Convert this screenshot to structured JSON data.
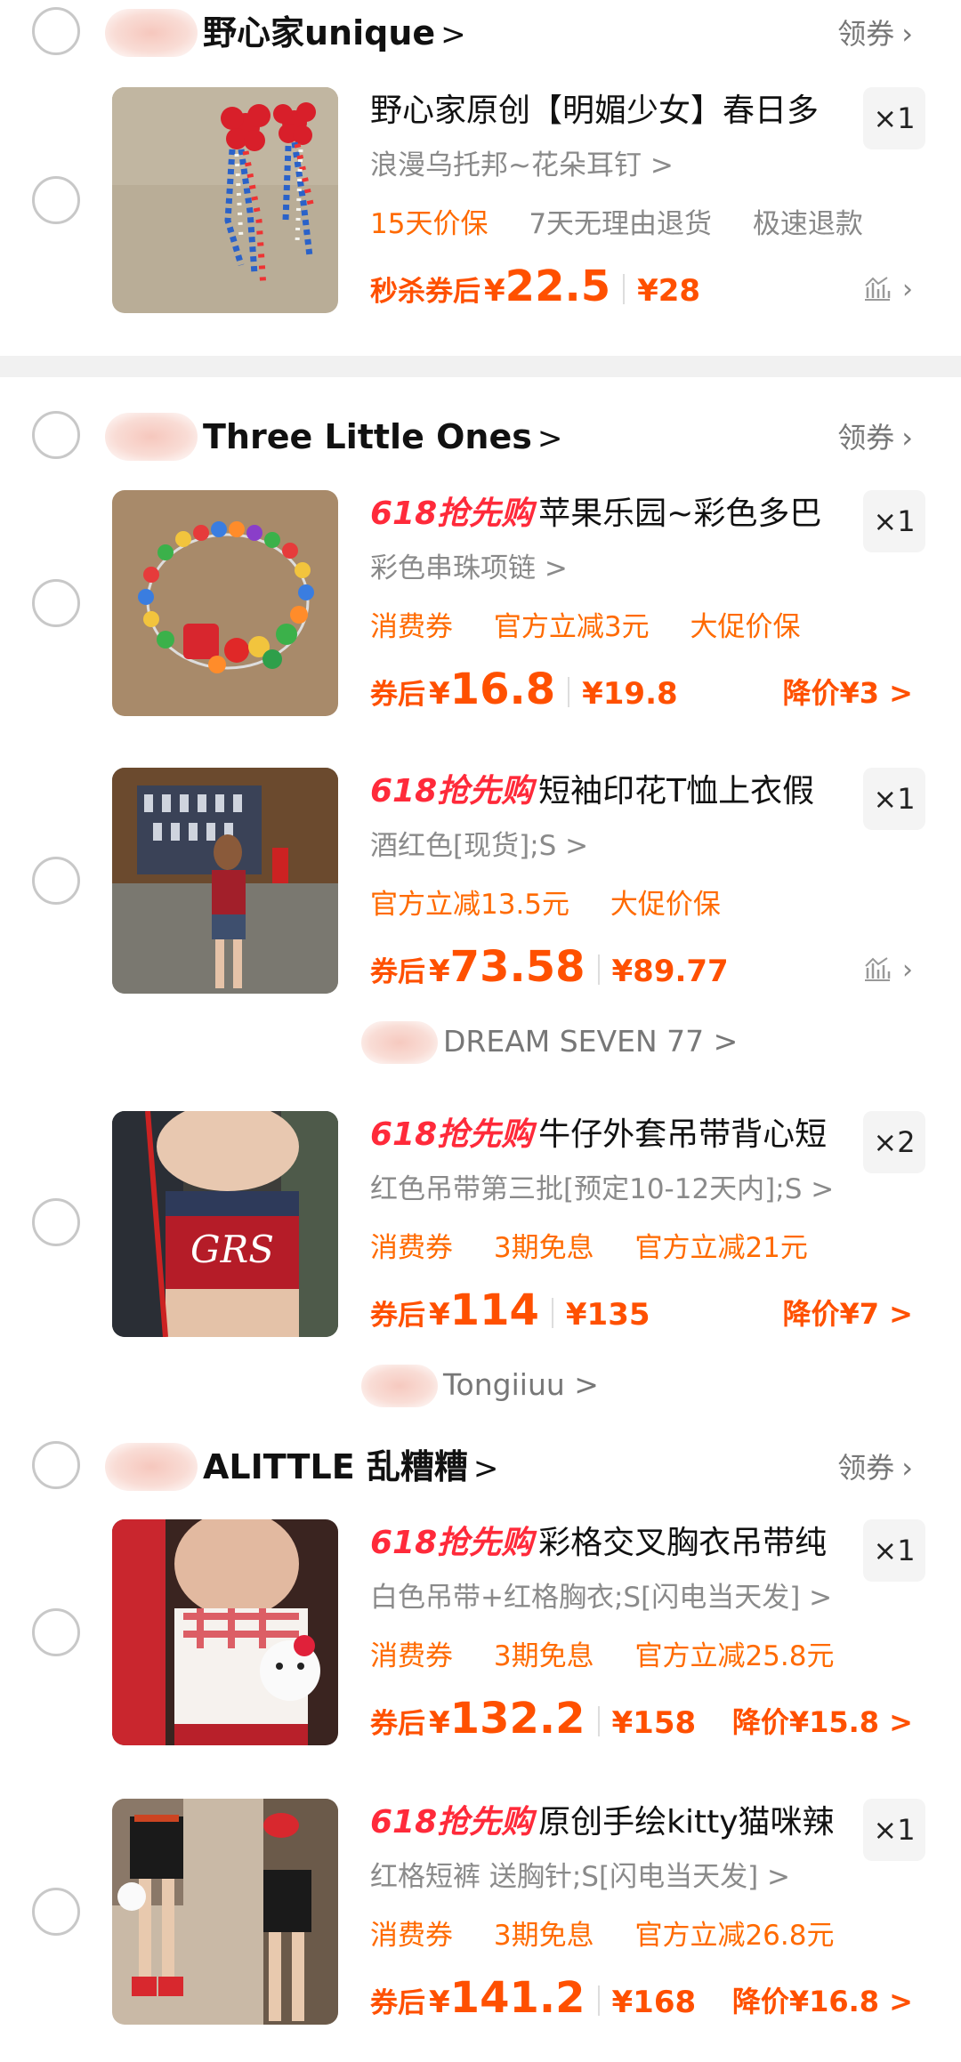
{
  "colors": {
    "price": "#ff5000",
    "tag": "#ff6a00",
    "promo618": "#ff2a3a",
    "divider": "#f1f1f1"
  },
  "shops": [
    {
      "name": "野心家unique",
      "chevron": ">",
      "coupon": "领券",
      "items": [
        {
          "title": "野心家原创【明媚少女】春日多",
          "promo": "",
          "qty": "×1",
          "sku": "浪漫乌托邦~花朵耳钉 >",
          "tags": [
            "15天价保",
            "7天无理由退货",
            "极速退款"
          ],
          "price_label": "秒杀券后",
          "price_currency": "¥",
          "price": "22.5",
          "original_price": "¥28",
          "right_action": "",
          "trend_icon": "chart-icon"
        }
      ]
    },
    {
      "name": "Three Little Ones",
      "chevron": ">",
      "coupon": "领券",
      "items": [
        {
          "title": "苹果乐园~彩色多巴",
          "promo": "618抢先购",
          "qty": "×1",
          "sku": "彩色串珠项链 >",
          "tags": [
            "消费券",
            "官方立减3元",
            "大促价保"
          ],
          "price_label": "券后",
          "price_currency": "¥",
          "price": "16.8",
          "original_price": "¥19.8",
          "right_action": "降价¥3 >"
        },
        {
          "title": "短袖印花T恤上衣假",
          "promo": "618抢先购",
          "qty": "×1",
          "sku": "酒红色[现货];S >",
          "tags": [
            "官方立减13.5元",
            "大促价保"
          ],
          "price_label": "券后",
          "price_currency": "¥",
          "price": "73.58",
          "original_price": "¥89.77",
          "right_action": "",
          "trend_icon": "chart-icon"
        }
      ]
    },
    {
      "sub_shop": "DREAM SEVEN 77 >",
      "items": [
        {
          "title": "牛仔外套吊带背心短",
          "promo": "618抢先购",
          "qty": "×2",
          "sku": "红色吊带第三批[预定10-12天内];S >",
          "tags": [
            "消费券",
            "3期免息",
            "官方立减21元"
          ],
          "price_label": "券后",
          "price_currency": "¥",
          "price": "114",
          "original_price": "¥135",
          "right_action": "降价¥7 >"
        }
      ]
    },
    {
      "sub_shop": "Tongiiuu >"
    },
    {
      "name": "ALITTLE 乱糟糟",
      "chevron": ">",
      "coupon": "领券",
      "items": [
        {
          "title": "彩格交叉胸衣吊带纯",
          "promo": "618抢先购",
          "qty": "×1",
          "sku": "白色吊带+红格胸衣;S[闪电当天发] >",
          "tags": [
            "消费券",
            "3期免息",
            "官方立减25.8元"
          ],
          "price_label": "券后",
          "price_currency": "¥",
          "price": "132.2",
          "original_price": "¥158",
          "right_action": "降价¥15.8 >"
        },
        {
          "title": "原创手绘kitty猫咪辣",
          "promo": "618抢先购",
          "qty": "×1",
          "sku": "红格短裤 送胸针;S[闪电当天发] >",
          "tags": [
            "消费券",
            "3期免息",
            "官方立减26.8元"
          ],
          "price_label": "券后",
          "price_currency": "¥",
          "price": "141.2",
          "original_price": "¥168",
          "right_action": "降价¥16.8 >"
        }
      ]
    }
  ]
}
